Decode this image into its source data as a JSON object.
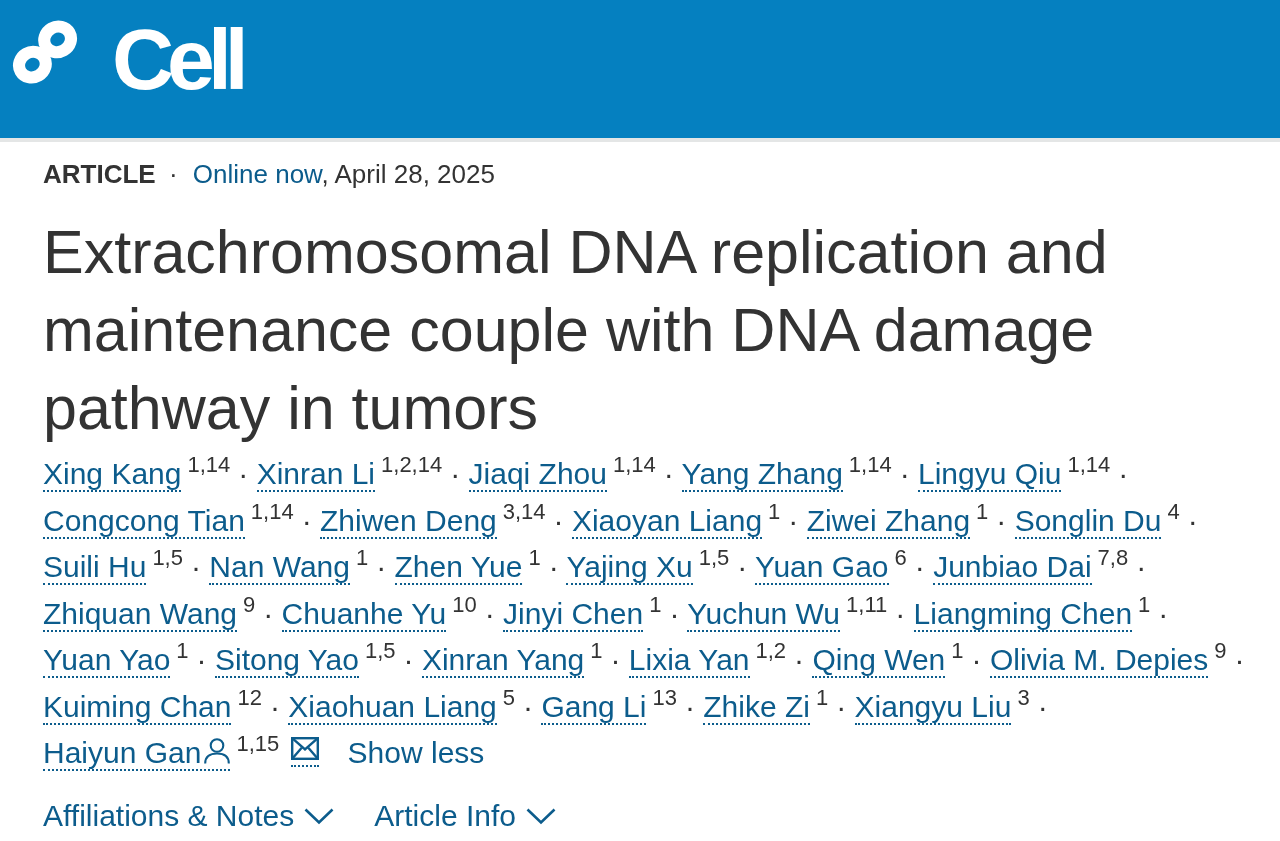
{
  "header": {
    "logo_text": "Cell"
  },
  "meta": {
    "article_type": "ARTICLE",
    "separator": "·",
    "status_link": "Online now",
    "date": ", April 28, 2025"
  },
  "title": "Extrachromosomal DNA replication and maintenance couple with DNA damage pathway in tumors",
  "authors": [
    {
      "name": "Xing Kang",
      "affiliations": "1,14",
      "separator": "·",
      "corresponding": false,
      "email": false
    },
    {
      "name": "Xinran Li",
      "affiliations": "1,2,14",
      "separator": "·",
      "corresponding": false,
      "email": false
    },
    {
      "name": "Jiaqi Zhou",
      "affiliations": "1,14",
      "separator": "·",
      "corresponding": false,
      "email": false
    },
    {
      "name": "Yang Zhang",
      "affiliations": "1,14",
      "separator": "·",
      "corresponding": false,
      "email": false
    },
    {
      "name": "Lingyu Qiu",
      "affiliations": "1,14",
      "separator": "·",
      "corresponding": false,
      "email": false
    },
    {
      "name": "Congcong Tian",
      "affiliations": "1,14",
      "separator": "·",
      "corresponding": false,
      "email": false
    },
    {
      "name": "Zhiwen Deng",
      "affiliations": "3,14",
      "separator": "·",
      "corresponding": false,
      "email": false
    },
    {
      "name": "Xiaoyan Liang",
      "affiliations": "1",
      "separator": "·",
      "corresponding": false,
      "email": false
    },
    {
      "name": "Ziwei Zhang",
      "affiliations": "1",
      "separator": "·",
      "corresponding": false,
      "email": false
    },
    {
      "name": "Songlin Du",
      "affiliations": "4",
      "separator": "·",
      "corresponding": false,
      "email": false
    },
    {
      "name": "Suili Hu",
      "affiliations": "1,5",
      "separator": "·",
      "corresponding": false,
      "email": false
    },
    {
      "name": "Nan Wang",
      "affiliations": "1",
      "separator": "·",
      "corresponding": false,
      "email": false
    },
    {
      "name": "Zhen Yue",
      "affiliations": "1",
      "separator": "·",
      "corresponding": false,
      "email": false
    },
    {
      "name": "Yajing Xu",
      "affiliations": "1,5",
      "separator": "·",
      "corresponding": false,
      "email": false
    },
    {
      "name": "Yuan Gao",
      "affiliations": "6",
      "separator": "·",
      "corresponding": false,
      "email": false
    },
    {
      "name": "Junbiao Dai",
      "affiliations": "7,8",
      "separator": "·",
      "corresponding": false,
      "email": false
    },
    {
      "name": "Zhiquan Wang",
      "affiliations": "9",
      "separator": "·",
      "corresponding": false,
      "email": false
    },
    {
      "name": "Chuanhe Yu",
      "affiliations": "10",
      "separator": "·",
      "corresponding": false,
      "email": false
    },
    {
      "name": "Jinyi Chen",
      "affiliations": "1",
      "separator": "·",
      "corresponding": false,
      "email": false
    },
    {
      "name": "Yuchun Wu",
      "affiliations": "1,11",
      "separator": "·",
      "corresponding": false,
      "email": false
    },
    {
      "name": "Liangming Chen",
      "affiliations": "1",
      "separator": "·",
      "corresponding": false,
      "email": false
    },
    {
      "name": "Yuan Yao",
      "affiliations": "1",
      "separator": "·",
      "corresponding": false,
      "email": false
    },
    {
      "name": "Sitong Yao",
      "affiliations": "1,5",
      "separator": "·",
      "corresponding": false,
      "email": false
    },
    {
      "name": "Xinran Yang",
      "affiliations": "1",
      "separator": "·",
      "corresponding": false,
      "email": false
    },
    {
      "name": "Lixia Yan",
      "affiliations": "1,2",
      "separator": "·",
      "corresponding": false,
      "email": false
    },
    {
      "name": "Qing Wen",
      "affiliations": "1",
      "separator": "·",
      "corresponding": false,
      "email": false
    },
    {
      "name": "Olivia M. Depies",
      "affiliations": "9",
      "separator": "·",
      "corresponding": false,
      "email": false
    },
    {
      "name": "Kuiming Chan",
      "affiliations": "12",
      "separator": "·",
      "corresponding": false,
      "email": false
    },
    {
      "name": "Xiaohuan Liang",
      "affiliations": "5",
      "separator": "·",
      "corresponding": false,
      "email": false
    },
    {
      "name": "Gang Li",
      "affiliations": "13",
      "separator": "·",
      "corresponding": false,
      "email": false
    },
    {
      "name": "Zhike Zi",
      "affiliations": "1",
      "separator": "·",
      "corresponding": false,
      "email": false
    },
    {
      "name": "Xiangyu Liu",
      "affiliations": "3",
      "separator": "·",
      "corresponding": false,
      "email": false
    },
    {
      "name": "Haiyun Gan",
      "affiliations": "1,15",
      "corresponding": true,
      "email": true
    }
  ],
  "author_toggle": "Show less",
  "sections": [
    {
      "label": "Affiliations & Notes",
      "expanded": false
    },
    {
      "label": "Article Info",
      "expanded": false
    }
  ]
}
